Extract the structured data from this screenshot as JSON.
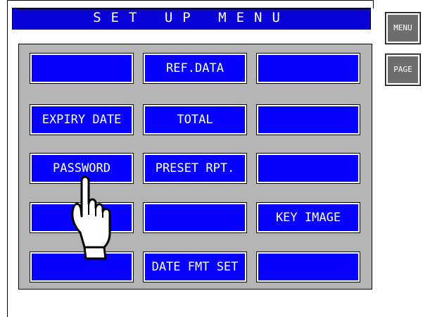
{
  "title": "SET UP MENU",
  "side_buttons": {
    "menu": "MENU",
    "page": "PAGE"
  },
  "grid": [
    [
      "",
      "REF.DATA",
      ""
    ],
    [
      "EXPIRY DATE",
      "TOTAL",
      ""
    ],
    [
      "PASSWORD",
      "PRESET RPT.",
      ""
    ],
    [
      "",
      "",
      "KEY IMAGE"
    ],
    [
      "",
      "DATE FMT SET",
      ""
    ]
  ],
  "colors": {
    "title_bar": "#0a00d8",
    "button_blue": "#0500ff",
    "panel_gray": "#b4b4b4",
    "side_button_gray": "#6e6e6e"
  },
  "icons": {
    "pointer": "pointing-hand-icon"
  }
}
